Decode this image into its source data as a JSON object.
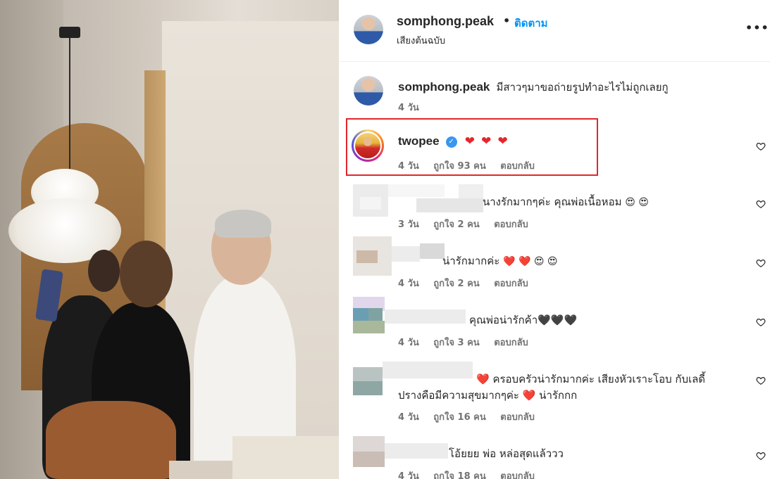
{
  "post": {
    "username": "somphong.peak",
    "dot": "•",
    "follow_label": "ติดตาม",
    "audio": "เสียงต้นฉบับ",
    "more": "•••"
  },
  "caption": {
    "username": "somphong.peak",
    "text": "มีสาวๆมาขอถ่ายรูปทำอะไรไม่ถูกเลยกู",
    "time": "4 วัน"
  },
  "comments": [
    {
      "username": "twopee",
      "verified": true,
      "text": "",
      "hearts": 3,
      "time": "4 วัน",
      "likes": "ถูกใจ 93 คน",
      "reply": "ตอบกลับ"
    },
    {
      "username": "",
      "text": "นางรักมากๆค่ะ คุณพ่อเนื้อหอม",
      "emoji": "😍 😍",
      "time": "3 วัน",
      "likes": "ถูกใจ 2 คน",
      "reply": "ตอบกลับ"
    },
    {
      "username": "",
      "text": "น่ารักมากค่ะ",
      "emoji": "❤️ ❤️ 😍 😍",
      "time": "4 วัน",
      "likes": "ถูกใจ 2 คน",
      "reply": "ตอบกลับ"
    },
    {
      "username": "",
      "text": "คุณพ่อน่ารักค้า🖤🖤🖤",
      "time": "4 วัน",
      "likes": "ถูกใจ 3 คน",
      "reply": "ตอบกลับ"
    },
    {
      "username": "",
      "line1": "❤️ ครอบครัวน่ารักมากค่ะ เสียงหัวเราะโอบ กับเลดี้",
      "line2": "ปรางคือมีความสุขมากๆค่ะ ❤️ น่ารักกก",
      "time": "4 วัน",
      "likes": "ถูกใจ 16 คน",
      "reply": "ตอบกลับ"
    },
    {
      "username": "",
      "text": "โอ้ยยย พ่อ หล่อสุดแล้ววว",
      "time": "4 วัน",
      "likes": "ถูกใจ 18 คน",
      "reply": "ตอบกลับ"
    }
  ],
  "colors": {
    "follow": "#0095f6",
    "highlight_box": "#e0272b",
    "meta": "#737373",
    "heart": "#e7252b"
  }
}
